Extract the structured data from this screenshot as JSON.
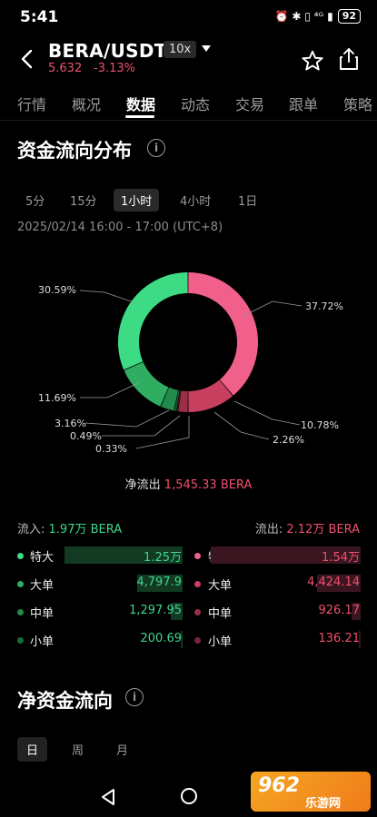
{
  "status": {
    "time": "5:41",
    "icons": "⏰ ✱ ▯ ⁴ᴳ ▮",
    "battery": "92"
  },
  "header": {
    "pair": "BERA/USDT",
    "leverage": "10x",
    "price": "5.632",
    "change": "-3.13%"
  },
  "tabs": [
    "行情",
    "概况",
    "数据",
    "动态",
    "交易",
    "跟单",
    "策略"
  ],
  "active_tab": "数据",
  "fund_flow": {
    "title": "资金流向分布",
    "periods": [
      "5分",
      "15分",
      "1小时",
      "4小时",
      "1日"
    ],
    "active_period": "1小时",
    "date_range": "2025/02/14 16:00 - 17:00 (UTC+8)",
    "net_label": "净流出",
    "net_value": "1,545.33 BERA",
    "inflow_label": "流入:",
    "inflow_value": "1.97万 BERA",
    "outflow_label": "流出:",
    "outflow_value": "2.12万 BERA",
    "labels": [
      "特大",
      "大单",
      "中单",
      "小单"
    ],
    "inflow_values": [
      "1.25万",
      "4,797.9",
      "1,297.95",
      "200.69"
    ],
    "outflow_values": [
      "1.54万",
      "4,424.14",
      "926.17",
      "136.21"
    ],
    "inflow_bar_fraction": [
      0.81,
      0.31,
      0.08,
      0.013
    ],
    "outflow_bar_fraction": [
      1.0,
      0.29,
      0.06,
      0.009
    ],
    "colors": {
      "in": [
        "#3ddc84",
        "#2fae62",
        "#228a4b",
        "#1a6b3a"
      ],
      "out": [
        "#f0608a",
        "#c8405f",
        "#9a3048",
        "#7a2638"
      ]
    }
  },
  "chart_data": {
    "type": "pie",
    "slices": [
      {
        "label": "37.72%",
        "value": 37.72
      },
      {
        "label": "10.78%",
        "value": 10.78
      },
      {
        "label": "2.26%",
        "value": 2.26
      },
      {
        "label": "0.33%",
        "value": 0.33
      },
      {
        "label": "0.49%",
        "value": 0.49
      },
      {
        "label": "3.16%",
        "value": 3.16
      },
      {
        "label": "11.69%",
        "value": 11.69
      },
      {
        "label": "30.59%",
        "value": 30.59
      }
    ]
  },
  "net_fund": {
    "title": "净资金流向",
    "periods": [
      "日",
      "周",
      "月"
    ],
    "active_period": "日"
  },
  "watermark": {
    "big": "962",
    "small": "乐游网"
  }
}
